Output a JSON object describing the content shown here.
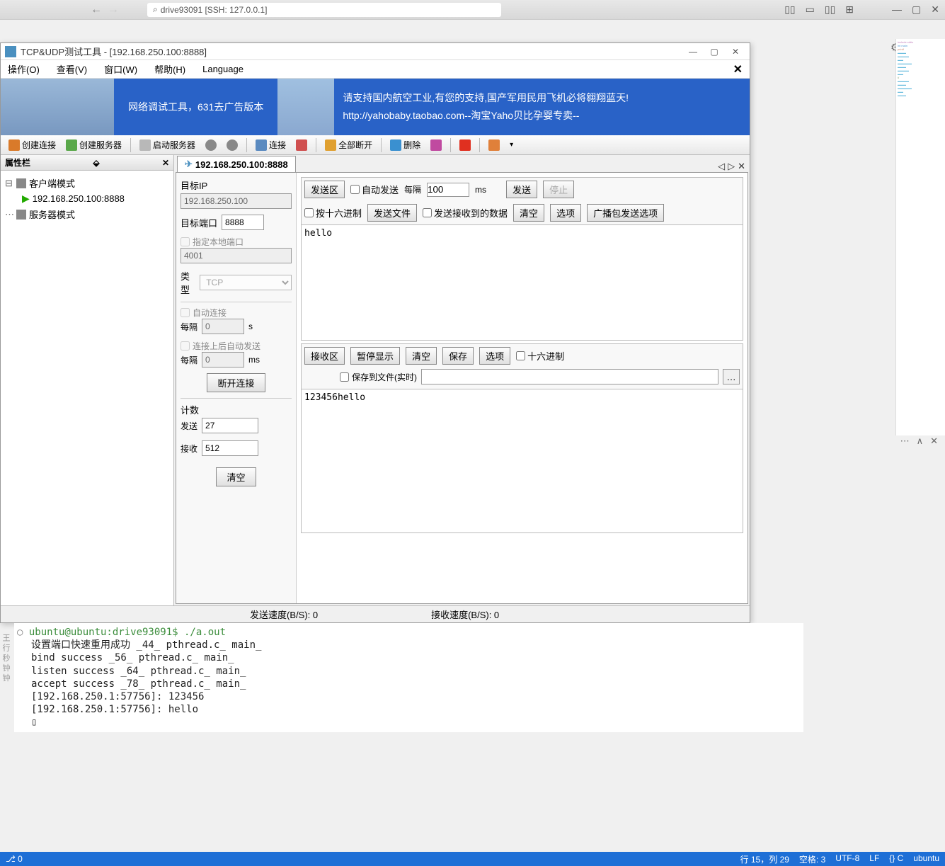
{
  "topbar": {
    "address": "drive93091 [SSH: 127.0.0.1]"
  },
  "app": {
    "title": "TCP&UDP测试工具 - [192.168.250.100:8888]"
  },
  "menu": {
    "operation": "操作(O)",
    "view": "查看(V)",
    "window": "窗口(W)",
    "help": "帮助(H)",
    "language": "Language"
  },
  "banner": {
    "text1": "网络调试工具，631去广告版本",
    "text2a": "请支持国内航空工业,有您的支持,国产军用民用飞机必将翱翔蓝天!",
    "text2b": "http://yahobaby.taobao.com--淘宝Yaho贝比孕婴专卖--"
  },
  "toolbar": {
    "create_conn": "创建连接",
    "create_server": "创建服务器",
    "start_server": "启动服务器",
    "connect": "连接",
    "disc_all": "全部断开",
    "delete": "删除"
  },
  "left_panel": {
    "title": "属性栏",
    "client_mode": "客户端模式",
    "conn_item": "192.168.250.100:8888",
    "server_mode": "服务器模式"
  },
  "tab": {
    "label": "192.168.250.100:8888"
  },
  "settings": {
    "target_ip_lbl": "目标IP",
    "target_ip_val": "192.168.250.100",
    "target_port_lbl": "目标端口",
    "target_port_val": "8888",
    "local_port_lbl": "指定本地端口",
    "local_port_val": "4001",
    "type_lbl": "类型",
    "type_val": "TCP",
    "auto_conn_lbl": "自动连接",
    "interval_lbl": "每隔",
    "interval1_val": "0",
    "interval1_unit": "s",
    "auto_send_after_lbl": "连接上后自动发送",
    "interval2_val": "0",
    "interval2_unit": "ms",
    "disconnect_btn": "断开连接",
    "count_lbl": "计数",
    "send_lbl": "发送",
    "send_count": "27",
    "recv_lbl": "接收",
    "recv_count": "512",
    "clear_btn": "清空"
  },
  "send_area": {
    "area_label": "发送区",
    "auto_send": "自动发送",
    "interval_lbl": "每隔",
    "interval_val": "100",
    "interval_unit": "ms",
    "send_btn": "发送",
    "stop_btn": "停止",
    "hex_send": "按十六进制",
    "send_file": "发送文件",
    "send_recv_data": "发送接收到的数据",
    "clear_btn": "清空",
    "options_btn": "选项",
    "broadcast_btn": "广播包发送选项",
    "content": "hello"
  },
  "recv_area": {
    "area_label": "接收区",
    "pause_btn": "暂停显示",
    "clear_btn": "清空",
    "save_btn": "保存",
    "options_btn": "选项",
    "hex_chk": "十六进制",
    "save_file_lbl": "保存到文件(实时)",
    "file_path": "",
    "content": "123456hello"
  },
  "status": {
    "send_speed": "发送速度(B/S): 0",
    "recv_speed": "接收速度(B/S): 0"
  },
  "terminal": {
    "lines": [
      "ubuntu@ubuntu:drive93091$ ./a.out",
      "设置端口快速重用成功 _44_ pthread.c_ main_",
      "bind success _56_ pthread.c_ main_",
      "listen success _64_ pthread.c_ main_",
      "accept success _78_ pthread.c_ main_",
      "[192.168.250.1:57756]: 123456",
      "[192.168.250.1:57756]: hello",
      "▯"
    ]
  },
  "bottom_status": {
    "left": "0",
    "line_col": "行 15，列 29",
    "spaces": "空格: 3",
    "encoding": "UTF-8",
    "eol": "LF",
    "lang": "{} C",
    "host": "ubuntu"
  }
}
